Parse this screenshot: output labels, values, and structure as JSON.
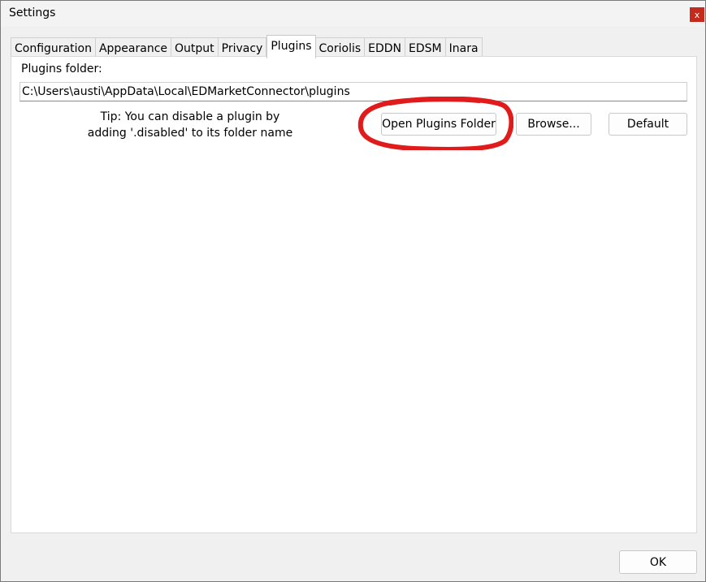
{
  "window": {
    "title": "Settings",
    "close_label": "x"
  },
  "tabs": [
    {
      "label": "Configuration",
      "active": false
    },
    {
      "label": "Appearance",
      "active": false
    },
    {
      "label": "Output",
      "active": false
    },
    {
      "label": "Privacy",
      "active": false
    },
    {
      "label": "Plugins",
      "active": true
    },
    {
      "label": "Coriolis",
      "active": false
    },
    {
      "label": "EDDN",
      "active": false
    },
    {
      "label": "EDSM",
      "active": false
    },
    {
      "label": "Inara",
      "active": false
    }
  ],
  "plugins": {
    "folder_label": "Plugins folder:",
    "folder_path": "C:\\Users\\austi\\AppData\\Local\\EDMarketConnector\\plugins",
    "tip_line1": "Tip: You can disable a plugin by",
    "tip_line2": "adding '.disabled' to its folder name",
    "open_folder_label": "Open Plugins Folder",
    "browse_label": "Browse...",
    "default_label": "Default"
  },
  "footer": {
    "ok_label": "OK"
  },
  "colors": {
    "highlight": "#e01b1b",
    "close_bg": "#c42b1c"
  }
}
